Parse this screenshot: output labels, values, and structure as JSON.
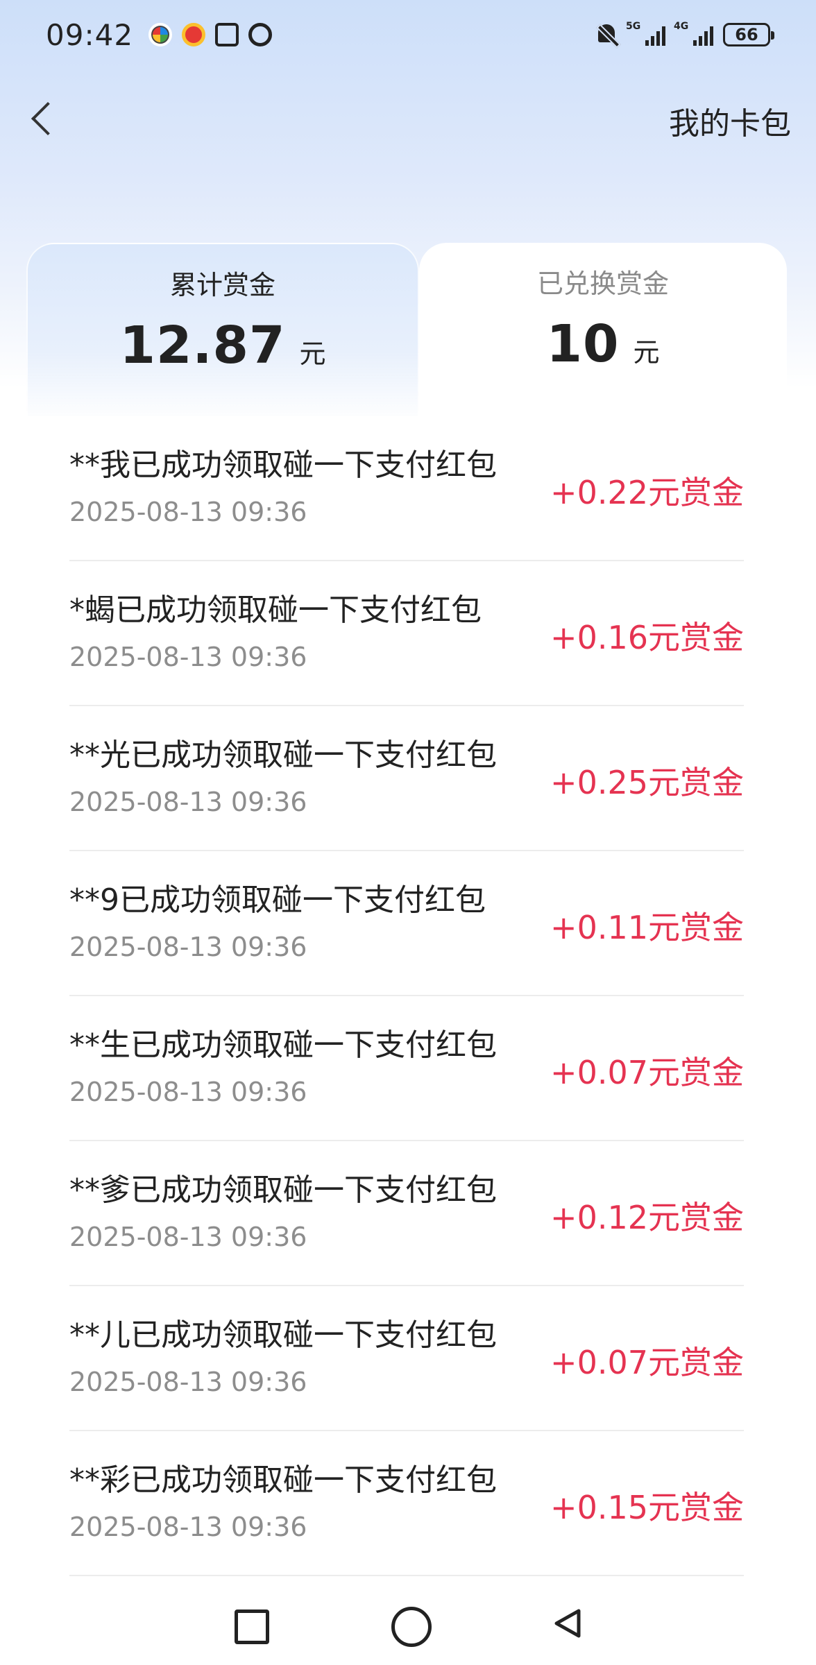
{
  "status": {
    "time": "09:42",
    "signal_5g_label": "5G",
    "signal_4g_label": "4G",
    "battery": "66"
  },
  "nav": {
    "title": "我的卡包"
  },
  "tabs": {
    "accumulated": {
      "label": "累计赏金",
      "value": "12.87",
      "unit": "元"
    },
    "redeemed": {
      "label": "已兑换赏金",
      "value": "10",
      "unit": "元"
    }
  },
  "records": [
    {
      "title": "**我已成功领取碰一下支付红包",
      "time": "2025-08-13 09:36",
      "amount": "+0.22元赏金"
    },
    {
      "title": "*蝎已成功领取碰一下支付红包",
      "time": "2025-08-13 09:36",
      "amount": "+0.16元赏金"
    },
    {
      "title": "**光已成功领取碰一下支付红包",
      "time": "2025-08-13 09:36",
      "amount": "+0.25元赏金"
    },
    {
      "title": "**9已成功领取碰一下支付红包",
      "time": "2025-08-13 09:36",
      "amount": "+0.11元赏金"
    },
    {
      "title": "**生已成功领取碰一下支付红包",
      "time": "2025-08-13 09:36",
      "amount": "+0.07元赏金"
    },
    {
      "title": "**爹已成功领取碰一下支付红包",
      "time": "2025-08-13 09:36",
      "amount": "+0.12元赏金"
    },
    {
      "title": "**儿已成功领取碰一下支付红包",
      "time": "2025-08-13 09:36",
      "amount": "+0.07元赏金"
    },
    {
      "title": "**彩已成功领取碰一下支付红包",
      "time": "2025-08-13 09:36",
      "amount": "+0.15元赏金"
    }
  ],
  "colors": {
    "amount": "#e53351",
    "background_top": "#cddff9"
  },
  "icons": {
    "back": "chevron-left-icon",
    "sys_recent": "square-icon",
    "sys_home": "circle-icon",
    "sys_back": "triangle-back-icon"
  }
}
